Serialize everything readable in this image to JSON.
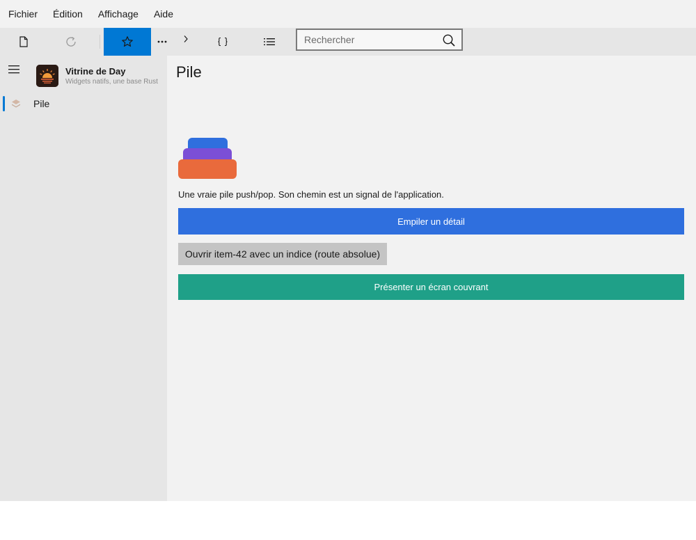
{
  "menubar": {
    "items": [
      "Fichier",
      "Édition",
      "Affichage",
      "Aide"
    ]
  },
  "toolbar": {
    "buttons": [
      "document-icon",
      "refresh-icon",
      "star-icon",
      "more-icon",
      "chevron-right-icon",
      "braces-icon",
      "list-icon"
    ],
    "active": "star-icon",
    "search_placeholder": "Rechercher"
  },
  "sidebar": {
    "app_name": "Vitrine de Day",
    "app_subtitle": "Widgets natifs, une base Rust",
    "items": [
      {
        "label": "Pile",
        "icon": "layers-icon",
        "selected": true
      }
    ]
  },
  "main": {
    "title": "Pile",
    "description": "Une vraie pile push/pop. Son chemin est un signal de l'application.",
    "buttons": {
      "push": "Empiler un détail",
      "open": "Ouvrir item-42 avec un indice (route absolue)",
      "present": "Présenter un écran couvrant"
    }
  },
  "colors": {
    "accent": "#0078d4",
    "primary_button": "#2f6fde",
    "teal_button": "#1fa088",
    "secondary_button": "#c4c4c4",
    "stack_blue": "#2f6fde",
    "stack_purple": "#7b4fd6",
    "stack_orange": "#e96a3c"
  }
}
